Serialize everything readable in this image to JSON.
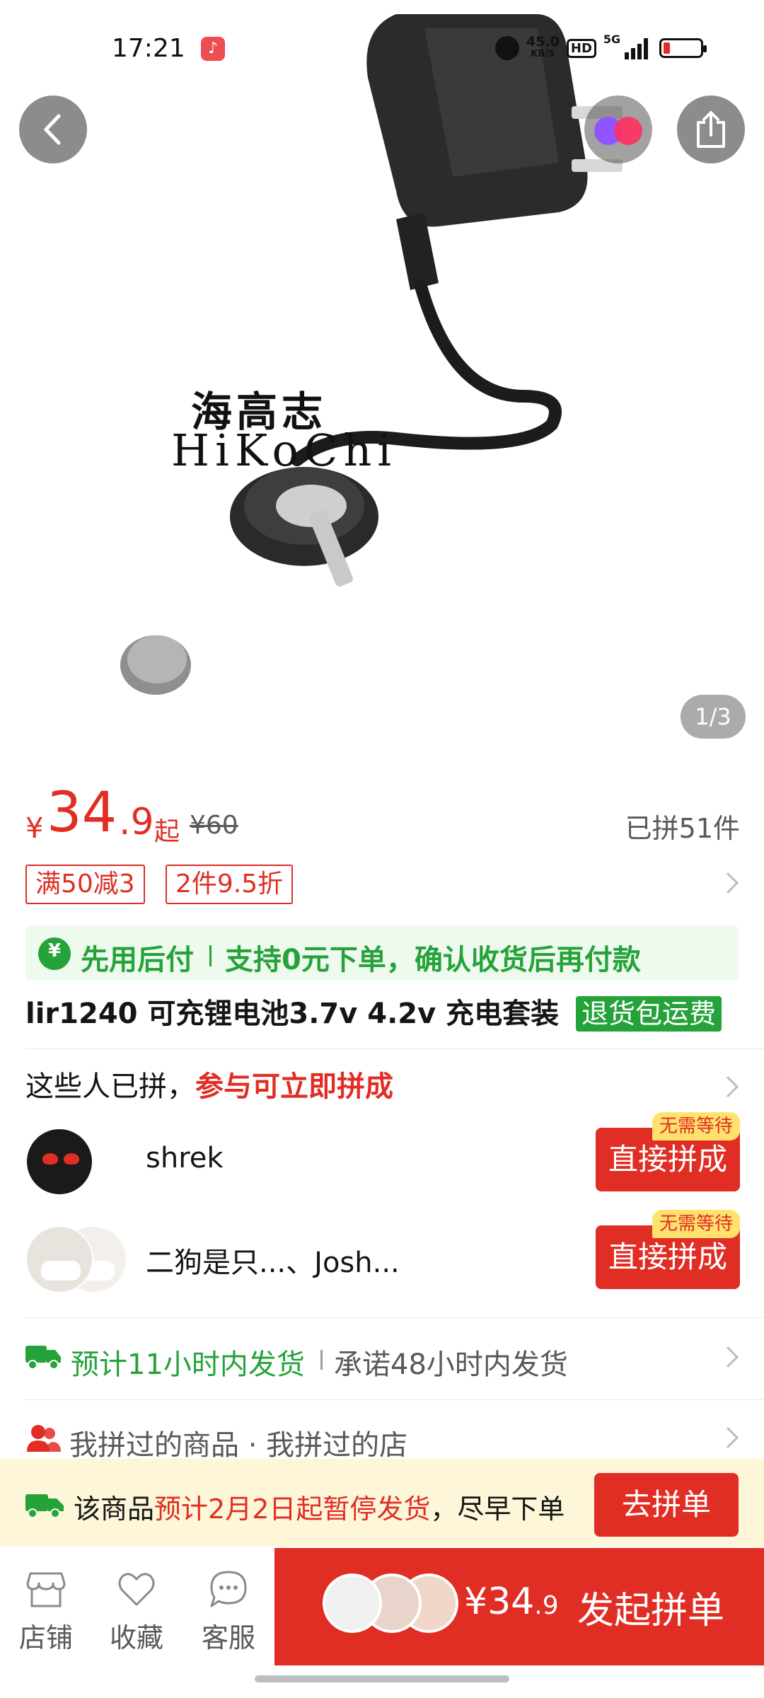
{
  "status_bar": {
    "time": "17:21",
    "speed_top": "45.0",
    "speed_bottom": "KB/S",
    "hd": "HD",
    "network": "5G",
    "battery_color": "#e5282a"
  },
  "hero": {
    "product_image_text_cn": "海高志",
    "product_image_text_en": "HiKoChi",
    "page_indicator": "1/3",
    "icons": [
      "back-icon",
      "brand-icon",
      "share-icon"
    ]
  },
  "price": {
    "symbol": "¥",
    "integer": "34",
    "decimal": ".9",
    "suffix": "起",
    "original": "¥60",
    "sold": "已拼51件"
  },
  "coupons": [
    "满50减3",
    "2件9.5折"
  ],
  "pay_later": {
    "title": "先用后付",
    "desc": "支持0元下单，确认收货后再付款"
  },
  "product": {
    "title": "lir1240 可充锂电池3.7v  4.2v  充电套装",
    "return_badge": "退货包运费"
  },
  "group": {
    "title_prefix": "这些人已拼，",
    "title_highlight": "参与可立即拼成",
    "rows": [
      {
        "name": "shrek",
        "button": "直接拼成",
        "tag": "无需等待"
      },
      {
        "name": "二狗是只...、Josh...",
        "button": "直接拼成",
        "tag": "无需等待"
      }
    ]
  },
  "shipping": {
    "promise_green": "预计11小时内发货",
    "promise_grey": "承诺48小时内发货"
  },
  "history": {
    "text": "我拼过的商品 · 我拼过的店"
  },
  "notice": {
    "prefix": "该商品",
    "highlight": "预计2月2日起暂停发货",
    "suffix": "，尽早下单",
    "button": "去拼单"
  },
  "bottom_nav": {
    "store": "店铺",
    "favorite": "收藏",
    "service": "客服",
    "buy_price_symbol": "¥",
    "buy_price_int": "34",
    "buy_price_dec": ".9",
    "buy_label": "发起拼单"
  },
  "colors": {
    "accent_red": "#e02e24",
    "green": "#25a33a",
    "notice_bg": "#fdf6d9"
  }
}
